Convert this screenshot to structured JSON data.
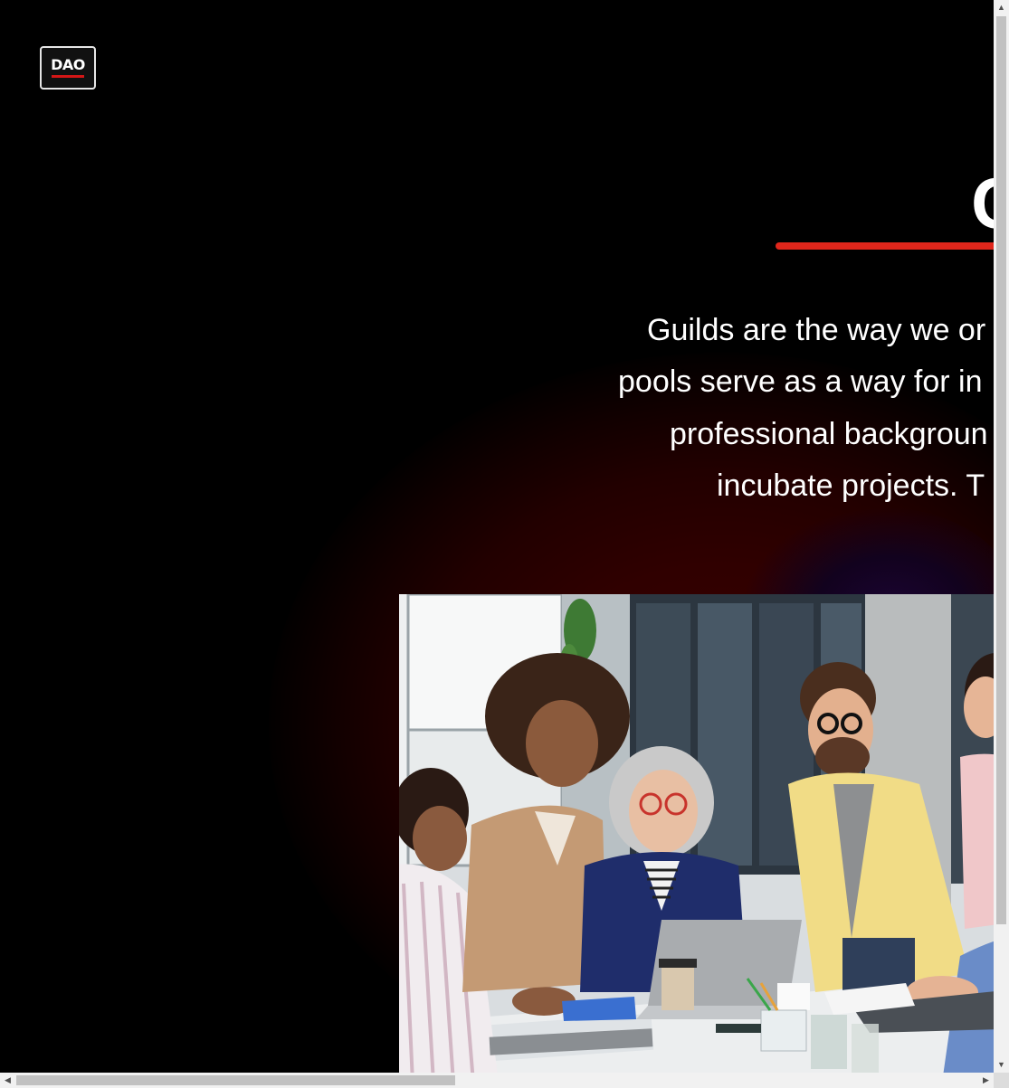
{
  "logo": {
    "text": "DAO"
  },
  "heading": {
    "visible_text": "C"
  },
  "intro": {
    "lines": [
      "Guilds are the way we or",
      "pools serve as a way for in",
      "professional backgroun",
      "incubate projects. T"
    ]
  },
  "photo": {
    "alt": "team-meeting-photo"
  },
  "colors": {
    "accent": "#e0261b",
    "background": "#000000",
    "glow": "#3a0000"
  },
  "scrollbars": {
    "up_icon": "arrow-up-icon",
    "down_icon": "arrow-down-icon",
    "left_icon": "arrow-left-icon",
    "right_icon": "arrow-right-icon"
  }
}
